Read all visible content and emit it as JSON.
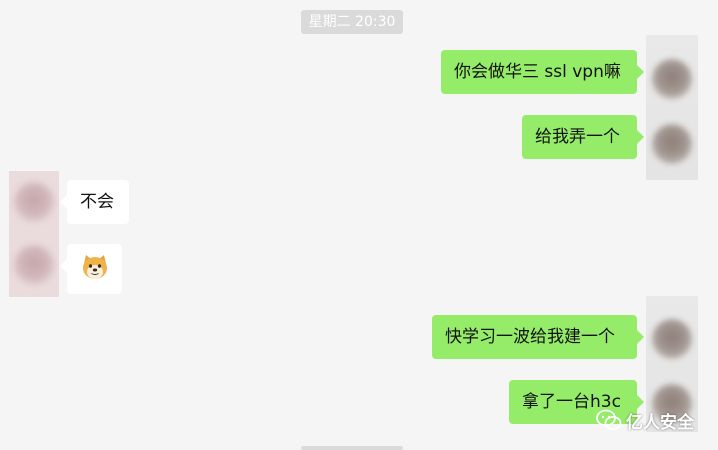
{
  "chat": {
    "timestamp": "星期二 20:30",
    "messages": [
      {
        "side": "mine",
        "text": "你会做华三 ssl vpn嘛"
      },
      {
        "side": "mine",
        "text": "给我弄一个"
      },
      {
        "side": "theirs",
        "text": "不会"
      },
      {
        "side": "theirs",
        "sticker": "doge-face-icon"
      },
      {
        "side": "mine",
        "text": "快学习一波给我建一个"
      },
      {
        "side": "mine",
        "text": "拿了一台h3c"
      }
    ]
  },
  "watermark": {
    "text": "亿人安全",
    "logo": "wechat-logo-icon"
  },
  "colors": {
    "background": "#f5f5f5",
    "mine_bubble": "#95ec69",
    "theirs_bubble": "#ffffff",
    "timestamp_bg": "#dadada"
  }
}
